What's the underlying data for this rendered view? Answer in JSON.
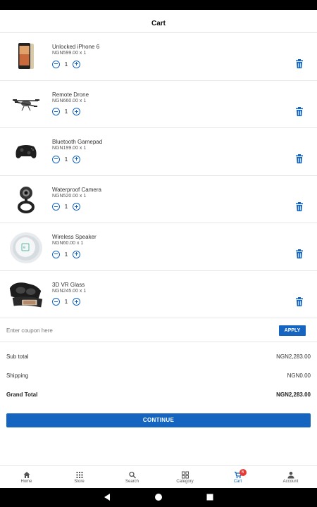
{
  "header": {
    "title": "Cart"
  },
  "items": [
    {
      "name": "Unlocked iPhone 6",
      "price": "NGN599.00 x 1",
      "qty": "1",
      "image_icon": "iphone-image"
    },
    {
      "name": "Remote Drone",
      "price": "NGN660.00 x 1",
      "qty": "1",
      "image_icon": "drone-image"
    },
    {
      "name": "Bluetooth Gamepad",
      "price": "NGN199.00 x 1",
      "qty": "1",
      "image_icon": "gamepad-image"
    },
    {
      "name": "Waterproof Camera",
      "price": "NGN520.00 x 1",
      "qty": "1",
      "image_icon": "webcam-image"
    },
    {
      "name": "Wireless Speaker",
      "price": "NGN60.00 x 1",
      "qty": "1",
      "image_icon": "speaker-image"
    },
    {
      "name": "3D VR Glass",
      "price": "NGN245.00 x 1",
      "qty": "1",
      "image_icon": "vr-glass-image"
    }
  ],
  "coupon": {
    "placeholder": "Enter coupon here",
    "value": "",
    "apply_label": "APPLY"
  },
  "summary": {
    "subtotal_label": "Sub total",
    "subtotal_value": "NGN2,283.00",
    "shipping_label": "Shipping",
    "shipping_value": "NGN0.00",
    "grand_label": "Grand Total",
    "grand_value": "NGN2,283.00"
  },
  "continue_label": "CONTINUE",
  "nav": {
    "items": [
      {
        "label": "Home",
        "icon": "home-icon"
      },
      {
        "label": "Store",
        "icon": "store-grid-icon"
      },
      {
        "label": "Search",
        "icon": "search-icon"
      },
      {
        "label": "Category",
        "icon": "category-icon"
      },
      {
        "label": "Cart",
        "icon": "cart-icon",
        "badge": "6",
        "active": true
      },
      {
        "label": "Account",
        "icon": "account-icon"
      }
    ]
  },
  "colors": {
    "accent": "#1565c0",
    "badge": "#e53935",
    "divider": "#e6e6e6"
  }
}
